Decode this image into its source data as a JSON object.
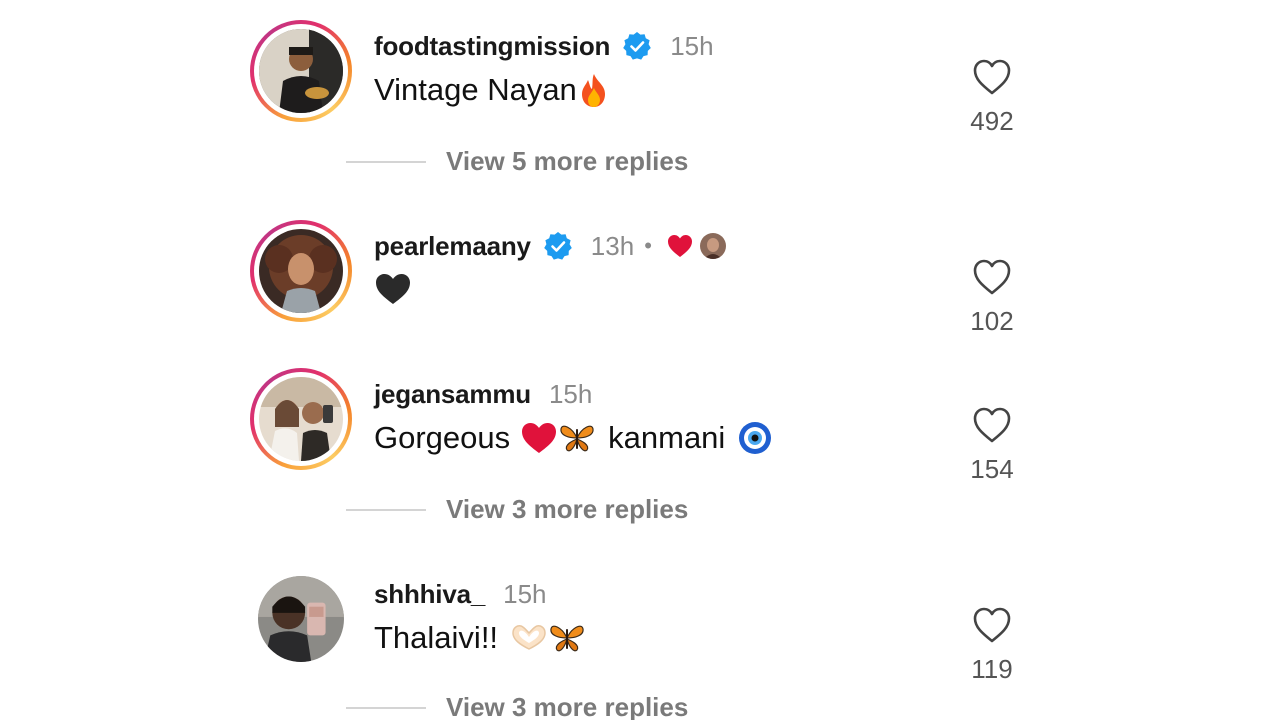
{
  "comments": [
    {
      "username": "foodtastingmission",
      "verified": true,
      "time": "15h",
      "text": "Vintage Nayan",
      "emoji": "fire",
      "likes": "492",
      "replies": "View 5 more replies"
    },
    {
      "username": "pearlemaany",
      "verified": true,
      "time": "13h",
      "separator": "•",
      "liked_by_creator": true,
      "emoji": "black-heart",
      "likes": "102"
    },
    {
      "username": "jegansammu",
      "verified": false,
      "time": "15h",
      "text_before": "Gorgeous",
      "text_after": "kanmani",
      "emojis": [
        "red-heart",
        "butterfly",
        "nazar-amulet"
      ],
      "likes": "154",
      "replies": "View 3 more replies"
    },
    {
      "username": "shhhiva_",
      "verified": false,
      "time": "15h",
      "text": "Thalaivi!!",
      "emojis": [
        "heart-hands",
        "butterfly"
      ],
      "likes": "119",
      "replies": "View 3 more replies"
    }
  ],
  "icons": {
    "like": "heart-outline-icon",
    "verified": "verified-badge-icon"
  },
  "colors": {
    "verified_blue": "#1d9bf0",
    "like_red": "#e0123b",
    "muted_text": "#8a8a8a"
  }
}
